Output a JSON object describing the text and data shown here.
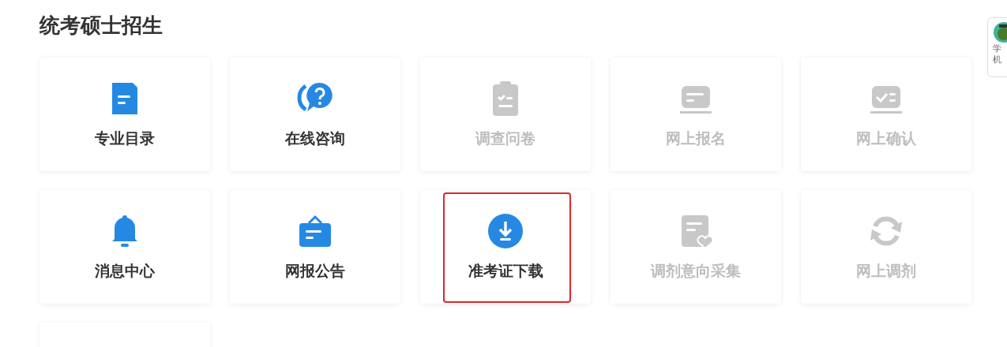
{
  "title": "统考硕士招生",
  "tiles": [
    {
      "kind": "document",
      "label": "专业目录",
      "disabled": false,
      "highlighted": false
    },
    {
      "kind": "chat",
      "label": "在线咨询",
      "disabled": false,
      "highlighted": false
    },
    {
      "kind": "clipboard",
      "label": "调查问卷",
      "disabled": true,
      "highlighted": false
    },
    {
      "kind": "laptop",
      "label": "网上报名",
      "disabled": true,
      "highlighted": false
    },
    {
      "kind": "laptop-check",
      "label": "网上确认",
      "disabled": true,
      "highlighted": false
    },
    {
      "kind": "bell",
      "label": "消息中心",
      "disabled": false,
      "highlighted": false
    },
    {
      "kind": "signboard",
      "label": "网报公告",
      "disabled": false,
      "highlighted": false
    },
    {
      "kind": "download",
      "label": "准考证下载",
      "disabled": false,
      "highlighted": true
    },
    {
      "kind": "form-heart",
      "label": "调剂意向采集",
      "disabled": true,
      "highlighted": false
    },
    {
      "kind": "refresh",
      "label": "网上调剂",
      "disabled": true,
      "highlighted": false
    },
    {
      "kind": "blank"
    }
  ],
  "side_widget": {
    "lines": [
      "学",
      "机"
    ]
  }
}
